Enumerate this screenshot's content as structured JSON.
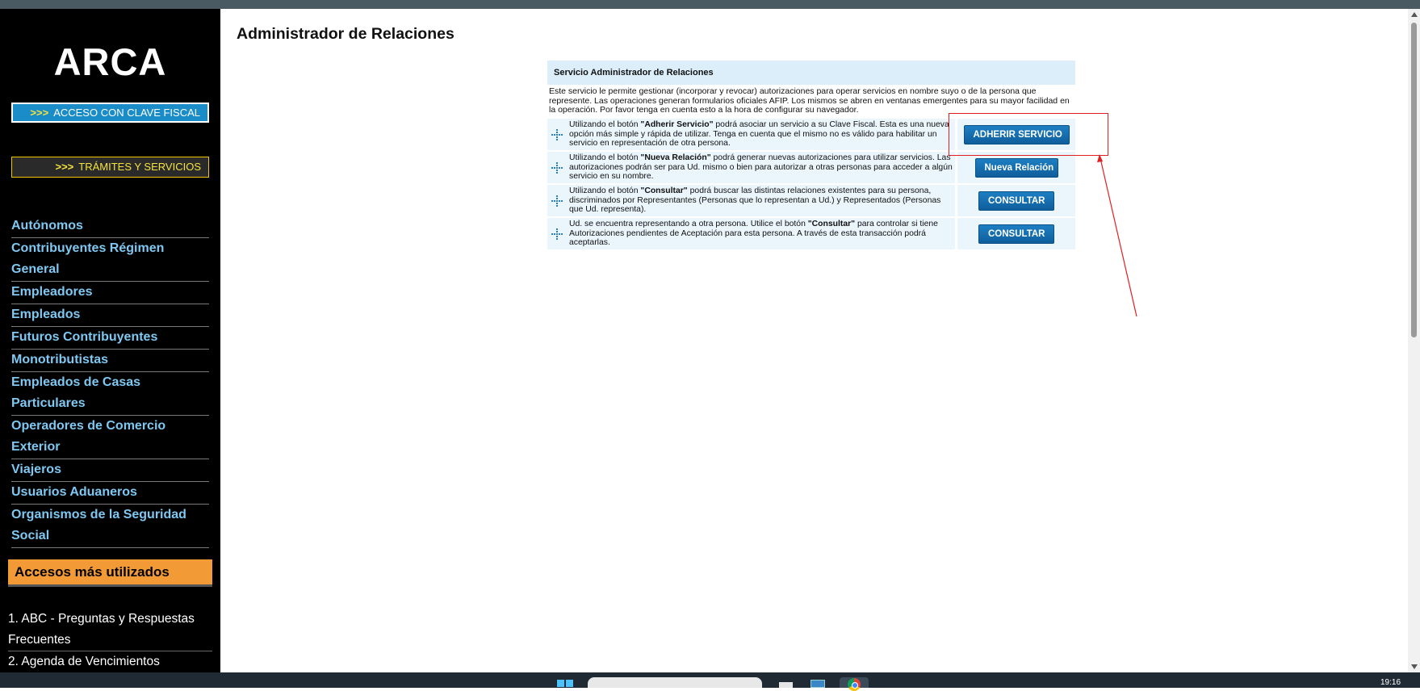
{
  "sidebar": {
    "logo": "ARCA",
    "clave_fiscal": {
      "arrows": ">>>",
      "label": "ACCESO CON CLAVE FISCAL"
    },
    "tramites": {
      "arrows": ">>>",
      "label": "TRÁMITES Y SERVICIOS"
    },
    "nav_items": [
      {
        "label": "Autónomos"
      },
      {
        "label": "Contribuyentes Régimen General"
      },
      {
        "label": "Empleadores"
      },
      {
        "label": "Empleados"
      },
      {
        "label": "Futuros Contribuyentes"
      },
      {
        "label": "Monotributistas"
      },
      {
        "label": "Empleados de Casas Particulares"
      },
      {
        "label": "Operadores de Comercio Exterior"
      },
      {
        "label": "Viajeros"
      },
      {
        "label": "Usuarios Aduaneros"
      },
      {
        "label": "Organismos de la Seguridad Social"
      }
    ],
    "accesos_title": "Accesos más utilizados",
    "accesos_items": [
      {
        "label": "1. ABC - Preguntas y Respuestas Frecuentes"
      },
      {
        "label": "2. Agenda de Vencimientos"
      }
    ]
  },
  "main": {
    "page_title": "Administrador de Relaciones",
    "panel_title": "Servicio Administrador de Relaciones",
    "intro": "Este servicio le permite gestionar (incorporar y revocar) autorizaciones para operar servicios en nombre suyo o de la persona que represente. Las operaciones generan formularios oficiales AFIP. Los mismos se abren en ventanas emergentes para su mayor facilidad en la operación. Por favor tenga en cuenta esto a la hora de configurar su navegador.",
    "rows": [
      {
        "pre": "Utilizando el botón ",
        "bold": "\"Adherir Servicio\"",
        "post": " podrá asociar un servicio a su Clave Fiscal. Esta es una nueva opción más simple y rápida de utilizar. Tenga en cuenta que el mismo no es válido para habilitar un servicio en representación de otra persona.",
        "button": "ADHERIR SERVICIO"
      },
      {
        "pre": "Utilizando el botón ",
        "bold": "\"Nueva Relación\"",
        "post": " podrá generar nuevas autorizaciones para utilizar servicios. Las autorizaciones podrán ser para Ud. mismo o bien para autorizar a otras personas para acceder a algún servicio en su nombre.",
        "button": "Nueva Relación"
      },
      {
        "pre": "Utilizando el botón ",
        "bold": "\"Consultar\"",
        "post": " podrá buscar las distintas relaciones existentes para su persona, discriminados por Representantes (Personas que lo representan a Ud.) y Representados (Personas que Ud. representa).",
        "button": "CONSULTAR"
      },
      {
        "pre": "Ud. se encuentra representando a otra persona. Utilice el botón ",
        "bold": "\"Consultar\"",
        "post": " para controlar si tiene Autorizaciones pendientes de Aceptación para esta persona. A través de esta transacción podrá aceptarlas.",
        "button": "CONSULTAR"
      }
    ]
  },
  "taskbar": {
    "time": "19:16"
  },
  "colors": {
    "accent": "#1a8cc8",
    "nav_link": "#7ec8f2",
    "accesos_header": "#f29a35",
    "annotation": "#e02020"
  }
}
